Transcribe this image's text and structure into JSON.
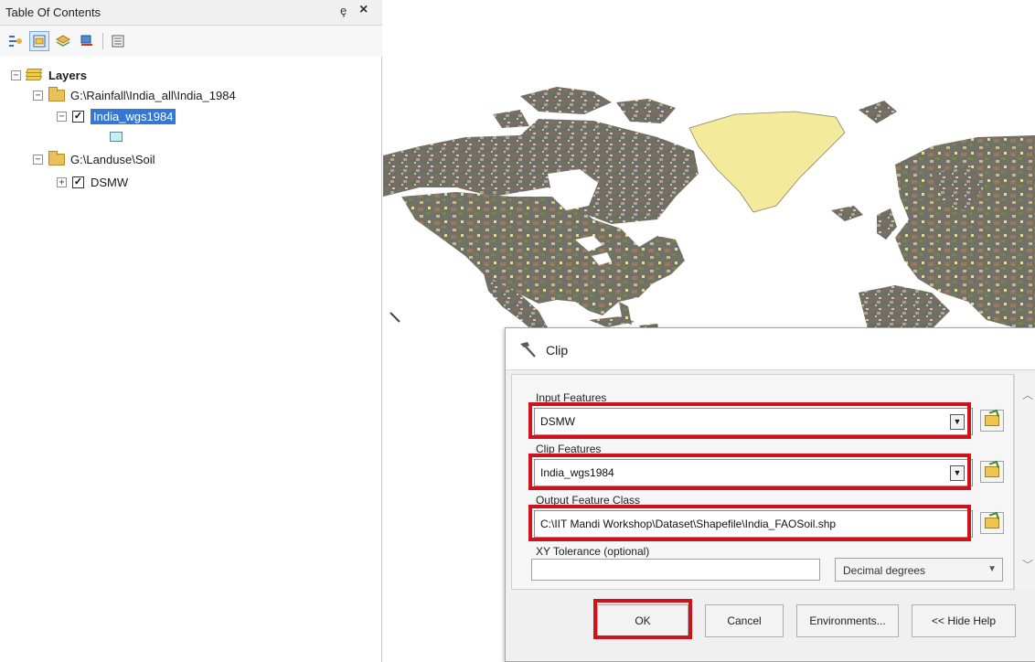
{
  "toc": {
    "title": "Table Of Contents",
    "pin_glyph": "ȩ",
    "close_glyph": "×",
    "toolbar": [
      "list-by-drawing-order-icon",
      "list-by-source-icon",
      "list-by-visibility-icon",
      "list-by-selection-icon",
      "options-icon"
    ],
    "tree": {
      "root": "Layers",
      "groups": [
        {
          "path": "G:\\Rainfall\\India_all\\India_1984",
          "layers": [
            {
              "name": "India_wgs1984",
              "checked": true,
              "selected": true
            }
          ]
        },
        {
          "path": "G:\\Landuse\\Soil",
          "layers": [
            {
              "name": "DSMW",
              "checked": true,
              "selected": false
            }
          ]
        }
      ]
    }
  },
  "dialog": {
    "title": "Clip",
    "icon": "hammer-icon",
    "input_features_label": "Input Features",
    "input_features_value": "DSMW",
    "clip_features_label": "Clip Features",
    "clip_features_value": "India_wgs1984",
    "output_label": "Output Feature Class",
    "output_value": "C:\\IIT Mandi Workshop\\Dataset\\Shapefile\\India_FAOSoil.shp",
    "tolerance_label": "XY Tolerance (optional)",
    "tolerance_value": "",
    "tolerance_units": "Decimal degrees",
    "buttons": {
      "ok": "OK",
      "cancel": "Cancel",
      "environments": "Environments...",
      "hide_help": "<< Hide Help"
    }
  },
  "colors": {
    "highlight": "#d0121b",
    "selection": "#3478d4",
    "land_dark": "#6b6b66",
    "land_brown": "#8a6a55",
    "greenland": "#f3ea9b",
    "green": "#7ba447"
  }
}
